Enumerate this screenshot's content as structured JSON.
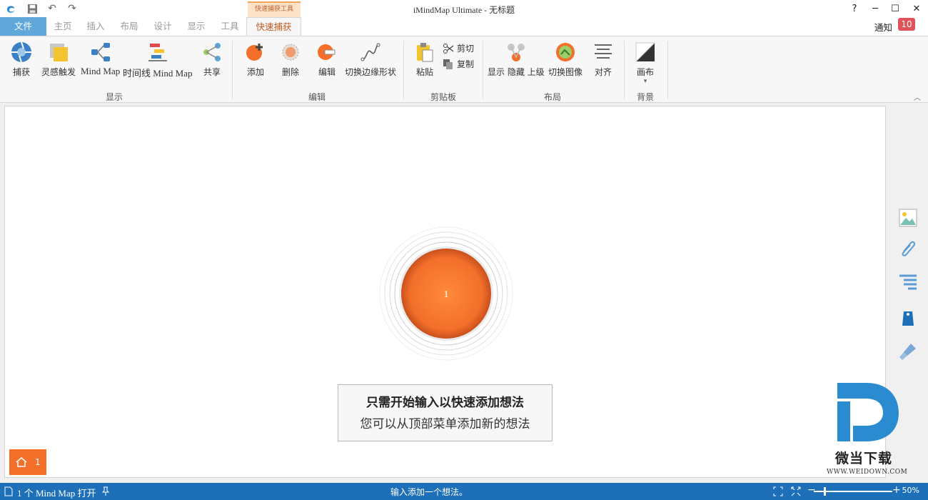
{
  "window": {
    "title": "iMindMap Ultimate - 无标题",
    "help": "?",
    "minimize": "─",
    "maximize": "☐",
    "close": "✕"
  },
  "tabs": {
    "file": "文件",
    "home": "主页",
    "insert": "插入",
    "layout": "布局",
    "design": "设计",
    "view": "显示",
    "tools": "工具",
    "quick_capture": "快速捕获",
    "context_group": "快速捕获工具"
  },
  "notify": {
    "label": "通知",
    "count": "10"
  },
  "ribbon": {
    "show": {
      "group": "显示",
      "capture": "捕获",
      "brainstorm": "灵感触发",
      "mindmap": "Mind Map",
      "timeline": "时间线 Mind Map",
      "share": "共享"
    },
    "edit": {
      "group": "编辑",
      "add": "添加",
      "delete": "删除",
      "edit": "编辑",
      "switch_edge": "切换边缘形状"
    },
    "clipboard": {
      "group": "剪贴板",
      "paste": "粘贴",
      "cut": "剪切",
      "copy": "复制"
    },
    "layout": {
      "group": "布局",
      "show_hide": "显示 隐藏 上级",
      "switch_image": "切换图像",
      "align": "对齐"
    },
    "background": {
      "group": "背景",
      "canvas": "画布",
      "canvas_arrow": "▾"
    }
  },
  "canvas": {
    "central_label": "1",
    "hint_title": "只需开始输入以快速添加想法",
    "hint_sub": "您可以从顶部菜单添加新的想法",
    "home_count": "1"
  },
  "watermark": {
    "name": "微当下载",
    "url": "WWW.WEIDOWN.COM"
  },
  "status": {
    "left": "1 个 Mind Map 打开",
    "center": "输入添加一个想法。",
    "zoom": "50%",
    "minus": "−",
    "plus": "+"
  },
  "colors": {
    "accent": "#1d6fb8",
    "node": "#f36f2a",
    "file_tab": "#5fa8d9",
    "badge": "#e0525a"
  }
}
